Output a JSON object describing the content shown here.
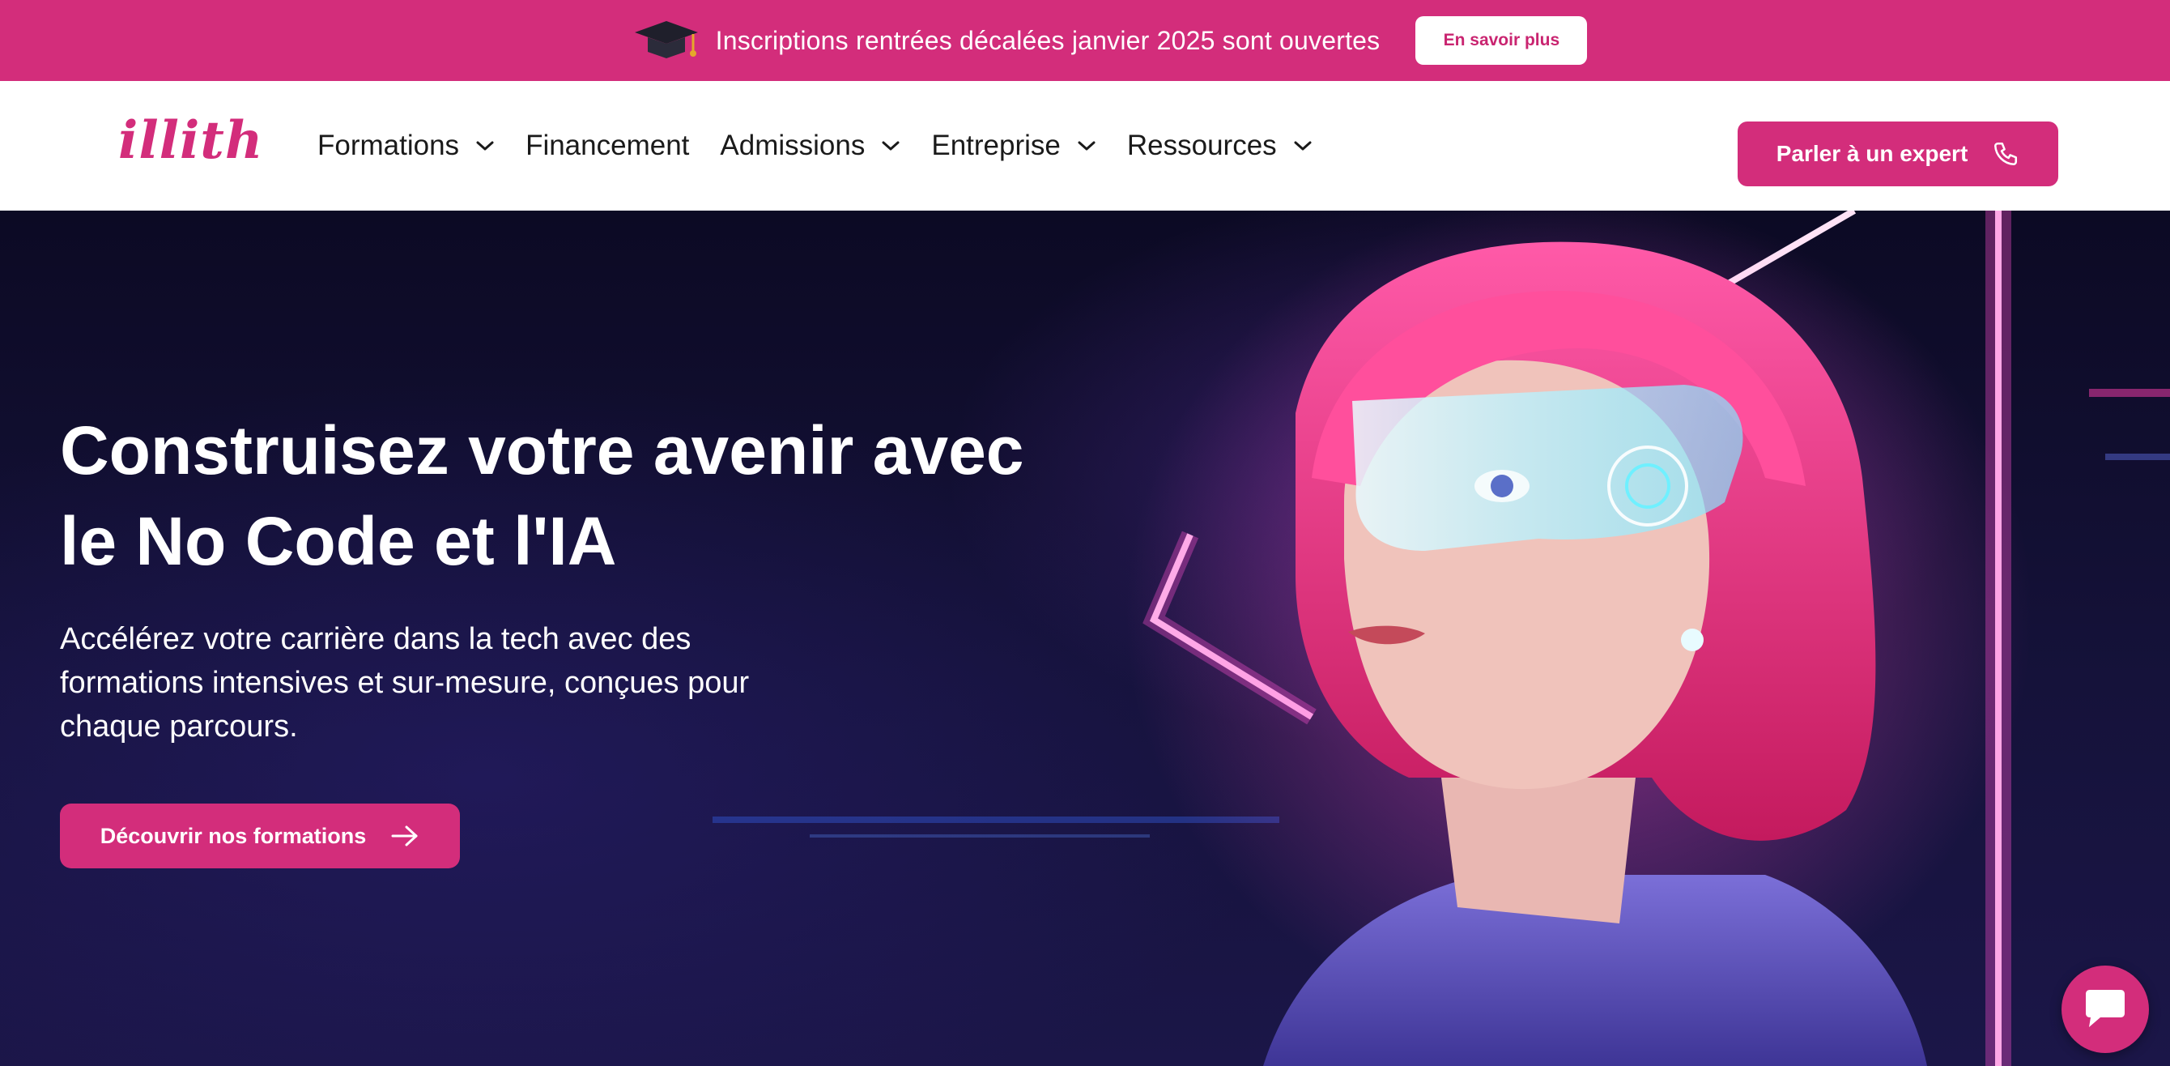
{
  "colors": {
    "brand": "#d32d7b",
    "nav_text": "#1a1a1a",
    "hero_bg": "#0d0b2a"
  },
  "promo": {
    "icon": "graduation-cap-icon",
    "text": "Inscriptions rentrées décalées janvier 2025 sont ouvertes",
    "button_label": "En savoir plus"
  },
  "nav": {
    "logo_text": "illith",
    "items": [
      {
        "label": "Formations",
        "has_dropdown": true
      },
      {
        "label": "Financement",
        "has_dropdown": false
      },
      {
        "label": "Admissions",
        "has_dropdown": true
      },
      {
        "label": "Entreprise",
        "has_dropdown": true
      },
      {
        "label": "Ressources",
        "has_dropdown": true
      }
    ],
    "cta_label": "Parler à un expert",
    "cta_icon": "phone-icon"
  },
  "hero": {
    "title_line1": "Construisez votre avenir avec",
    "title_line2": "le No Code et l'IA",
    "subtitle_line1": "Accélérez votre carrière dans la tech avec des",
    "subtitle_line2": "formations intensives et sur-mesure, conçues pour",
    "subtitle_line3": "chaque parcours.",
    "button_label": "Découvrir nos formations",
    "button_icon": "arrow-right-icon",
    "image": "woman-with-holographic-visor-illustration"
  },
  "chat": {
    "icon": "chat-bubble-icon"
  }
}
